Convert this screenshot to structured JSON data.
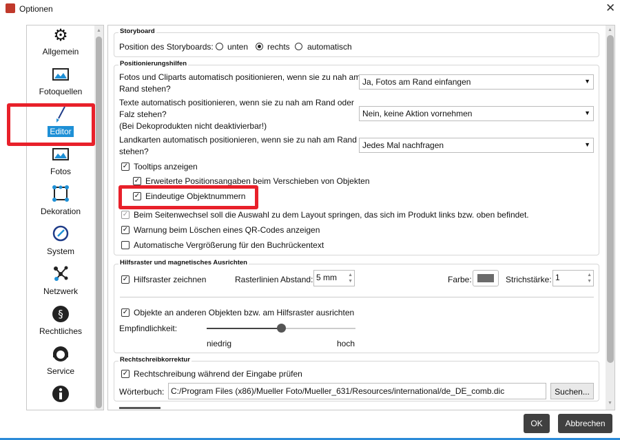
{
  "window": {
    "title": "Optionen",
    "close_icon": "close-icon"
  },
  "sidebar": {
    "items": [
      {
        "label": "Allgemein",
        "icon": "gear-icon"
      },
      {
        "label": "Fotoquellen",
        "icon": "image-icon"
      },
      {
        "label": "Editor",
        "icon": "brush-icon",
        "selected": true
      },
      {
        "label": "Fotos",
        "icon": "image-icon"
      },
      {
        "label": "Dekoration",
        "icon": "shape-icon"
      },
      {
        "label": "System",
        "icon": "gauge-icon"
      },
      {
        "label": "Netzwerk",
        "icon": "network-icon"
      },
      {
        "label": "Rechtliches",
        "icon": "paragraph-icon"
      },
      {
        "label": "Service",
        "icon": "headset-icon"
      },
      {
        "label": "",
        "icon": "info-icon"
      }
    ]
  },
  "storyboard": {
    "title": "Storyboard",
    "label": "Position des Storyboards:",
    "options": [
      "unten",
      "rechts",
      "automatisch"
    ],
    "selected": "rechts"
  },
  "positioning": {
    "title": "Positionierungshilfen",
    "photos_label": [
      "Fotos und Cliparts automatisch positionieren, wenn sie zu nah am",
      "Rand stehen?"
    ],
    "photos_value": "Ja, Fotos am Rand einfangen",
    "texts_label": [
      "Texte automatisch positionieren, wenn sie zu nah am Rand oder",
      "Falz stehen?",
      "(Bei Dekoprodukten nicht deaktivierbar!)"
    ],
    "texts_value": "Nein, keine Aktion vornehmen",
    "maps_label": [
      "Landkarten automatisch positionieren, wenn sie zu nah am Rand",
      "stehen?"
    ],
    "maps_value": "Jedes Mal nachfragen",
    "checks": [
      {
        "label": "Tooltips anzeigen",
        "checked": true
      },
      {
        "label": "Erweiterte Positionsangaben beim Verschieben von Objekten",
        "checked": true
      },
      {
        "label": "Eindeutige Objektnummern",
        "checked": true
      },
      {
        "label": "Beim Seitenwechsel soll die Auswahl zu dem Layout springen, das sich im Produkt links bzw. oben befindet.",
        "checked": true,
        "disabled": true
      },
      {
        "label": "Warnung beim Löschen eines QR-Codes anzeigen",
        "checked": true
      },
      {
        "label": "Automatische Vergrößerung für den Buchrückentext",
        "checked": false
      }
    ]
  },
  "grid": {
    "title": "Hilfsraster und magnetisches Ausrichten",
    "draw_label": "Hilfsraster zeichnen",
    "spacing_label": "Rasterlinien Abstand:",
    "spacing_value": "5 mm",
    "color_label": "Farbe:",
    "color": "#6b6b6b",
    "stroke_label": "Strichstärke:",
    "stroke_value": "1",
    "snap_label": "Objekte an anderen Objekten bzw. am Hilfsraster ausrichten",
    "sensitivity_label": "Empfindlichkeit:",
    "sensitivity_value": 0.5,
    "low": "niedrig",
    "high": "hoch"
  },
  "spelling": {
    "title": "Rechtschreibkorrektur",
    "check_label": "Rechtschreibung während der Eingabe prüfen",
    "dict_label": "Wörterbuch:",
    "dict_value": "C:/Program Files (x86)/Mueller Foto/Mueller_631/Resources/international/de_DE_comb.dic",
    "search_button": "Suchen..."
  },
  "footer": {
    "ok": "OK",
    "cancel": "Abbrechen"
  },
  "highlight_color": "#e8202a"
}
